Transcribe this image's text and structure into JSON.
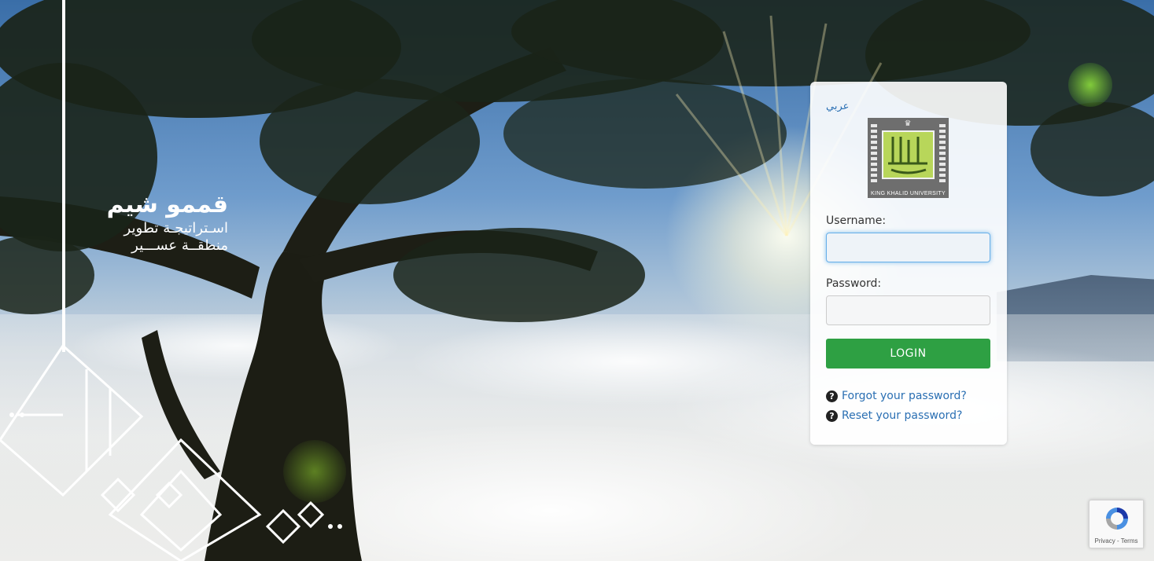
{
  "branding": {
    "title": "قممو شيم",
    "subtitle_line1": "اسـتراتيجـة تطوير",
    "subtitle_line2": "منطقــة عســـير"
  },
  "login": {
    "language_link": "عربي",
    "logo_caption": "KING KHALID UNIVERSITY",
    "username_label": "Username:",
    "username_value": "",
    "password_label": "Password:",
    "password_value": "",
    "login_button": "LOGIN",
    "forgot_password": "Forgot your password?",
    "reset_password": "Reset your password?"
  },
  "recaptcha": {
    "footer": "Privacy - Terms"
  },
  "colors": {
    "login_button": "#2ea043",
    "link": "#2a6fb3",
    "logo_green": "#b8d65a"
  }
}
